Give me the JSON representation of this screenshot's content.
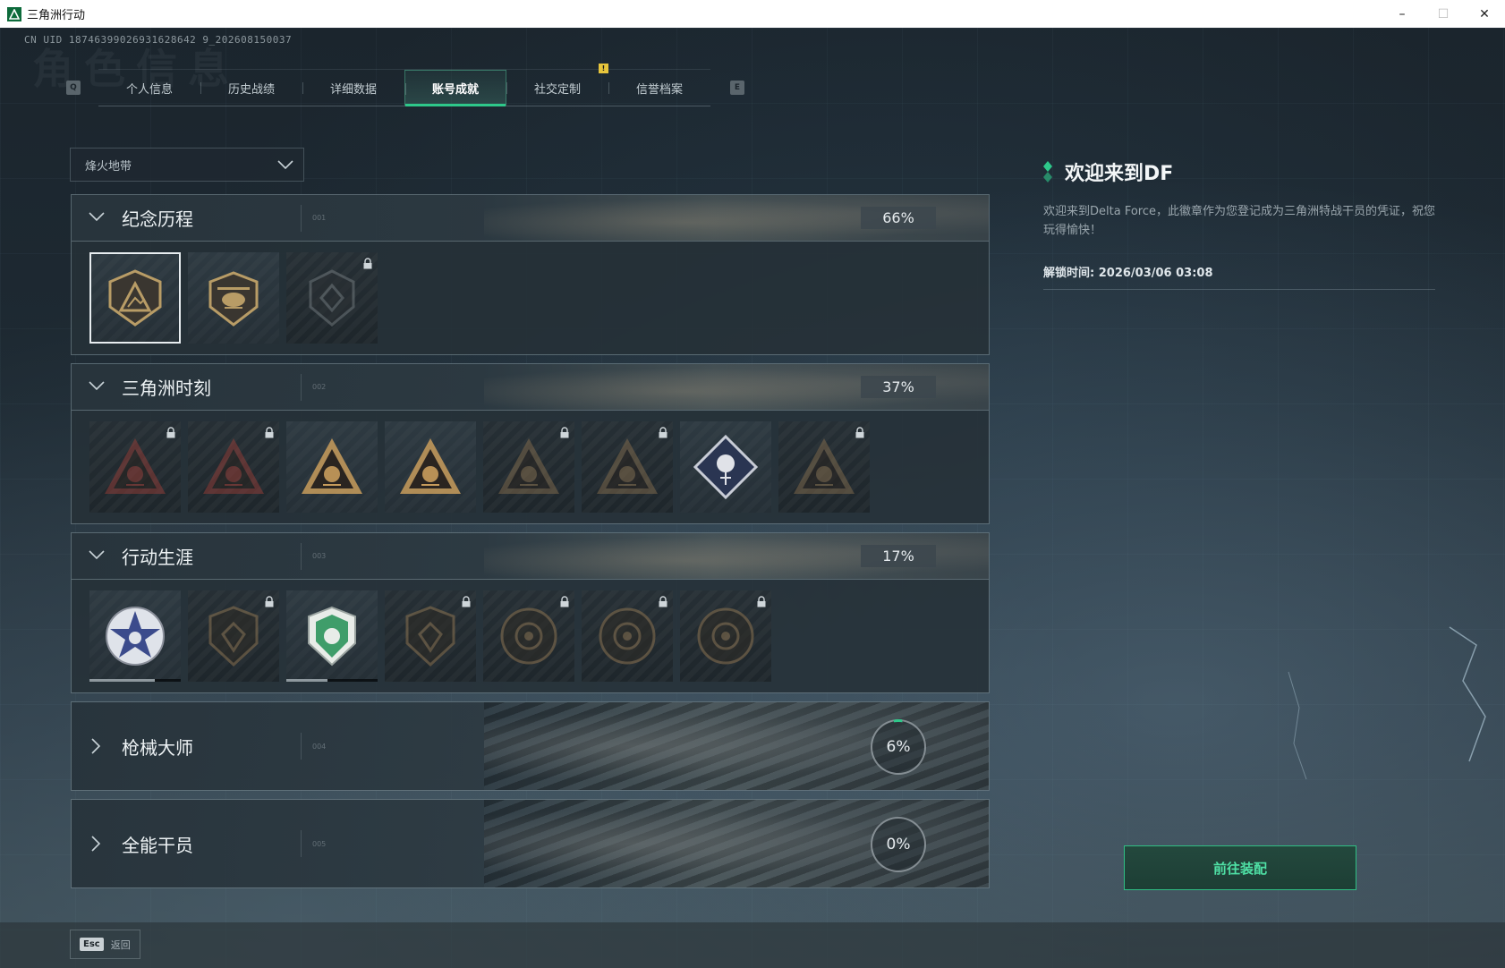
{
  "window": {
    "title": "三角洲行动",
    "minimize": "–",
    "maximize": "☐",
    "close": "✕"
  },
  "uid_text": "CN UID 18746399026931628642 9_202608150037",
  "watermark": "角色信息",
  "tabbar": {
    "left_key": "Q",
    "right_key": "E",
    "tabs": [
      {
        "label": "个人信息",
        "active": false
      },
      {
        "label": "历史战绩",
        "active": false
      },
      {
        "label": "详细数据",
        "active": false
      },
      {
        "label": "账号成就",
        "active": true
      },
      {
        "label": "社交定制",
        "active": false,
        "notice": "!"
      },
      {
        "label": "信誉档案",
        "active": false
      }
    ]
  },
  "mode_select": {
    "value": "烽火地带"
  },
  "sections": [
    {
      "title": "纪念历程",
      "code": "001",
      "progress": "66%",
      "expanded": true,
      "badges": [
        {
          "icon": "triangle-shield-badge",
          "locked": false,
          "selected": true,
          "color": "#b89c66"
        },
        {
          "icon": "helicopter-badge",
          "locked": false,
          "selected": false,
          "color": "#b89c66"
        },
        {
          "icon": "diamond-shield-badge",
          "locked": true,
          "selected": false,
          "color": "#6f777b"
        }
      ]
    },
    {
      "title": "三角洲时刻",
      "code": "002",
      "progress": "37%",
      "expanded": true,
      "badges": [
        {
          "icon": "robot-triangle-badge",
          "locked": true,
          "color": "#a04038"
        },
        {
          "icon": "runner-triangle-badge",
          "locked": true,
          "color": "#a04038"
        },
        {
          "icon": "dice-triangle-badge",
          "locked": false,
          "color": "#c89c5c"
        },
        {
          "icon": "soldiers-triangle-badge",
          "locked": false,
          "color": "#c89c5c"
        },
        {
          "icon": "wolf-triangle-badge",
          "locked": true,
          "color": "#8b7250"
        },
        {
          "icon": "fish-triangle-badge",
          "locked": true,
          "color": "#8b7250"
        },
        {
          "icon": "rose-diamond-badge",
          "locked": false,
          "color": "#c8ccd6"
        },
        {
          "icon": "bird-triangle-badge",
          "locked": true,
          "color": "#8b7250"
        }
      ]
    },
    {
      "title": "行动生涯",
      "code": "003",
      "progress": "17%",
      "expanded": true,
      "badges": [
        {
          "icon": "star-wolf-badge",
          "locked": false,
          "progress": 0.72,
          "color": "#3b4b8c"
        },
        {
          "icon": "flame-shield-badge",
          "locked": true,
          "color": "#8b7250"
        },
        {
          "icon": "green-shield-badge",
          "locked": false,
          "progress": 0.45,
          "color": "#3f9d6a"
        },
        {
          "icon": "dice-shield-badge",
          "locked": true,
          "color": "#8b7250"
        },
        {
          "icon": "planet-badge",
          "locked": true,
          "color": "#8b7250"
        },
        {
          "icon": "skull-target-badge",
          "locked": true,
          "color": "#8b7250"
        },
        {
          "icon": "eye-badge",
          "locked": true,
          "color": "#8b7250"
        }
      ]
    },
    {
      "title": "枪械大师",
      "code": "004",
      "progress": "6%",
      "expanded": false
    },
    {
      "title": "全能干员",
      "code": "005",
      "progress": "0%",
      "expanded": false
    }
  ],
  "info": {
    "title": "欢迎来到DF",
    "description": "欢迎来到Delta Force，此徽章作为您登记成为三角洲特战干员的凭证，祝您玩得愉快！",
    "unlock_time": "解锁时间: 2026/03/06 03:08"
  },
  "equip_button": "前往装配",
  "esc": {
    "key": "Esc",
    "label": "返回"
  },
  "colors": {
    "accent": "#2ec88a",
    "notice": "#e7c53c"
  }
}
